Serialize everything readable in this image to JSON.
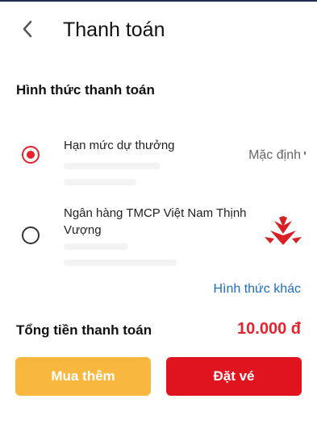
{
  "header": {
    "title": "Thanh toán",
    "back_icon": "chevron-left-icon"
  },
  "payment": {
    "section_title": "Hình thức thanh toán",
    "options": [
      {
        "label": "Hạn mức dự thưởng",
        "badge": "Mặc định",
        "selected": true
      },
      {
        "label": "Ngân hàng TMCP Việt Nam Thịnh Vượng",
        "logo": "vpbank-logo",
        "selected": false
      }
    ],
    "other_link": "Hình thức khác"
  },
  "summary": {
    "total_label": "Tổng tiền thanh toán",
    "total_value": "10.000 đ"
  },
  "actions": {
    "buy_more": "Mua thêm",
    "place_order": "Đặt vé"
  },
  "colors": {
    "accent": "#e5232e",
    "link": "#1e6fbf",
    "secondary_button": "#f8b840",
    "primary_button": "#e0141e"
  }
}
